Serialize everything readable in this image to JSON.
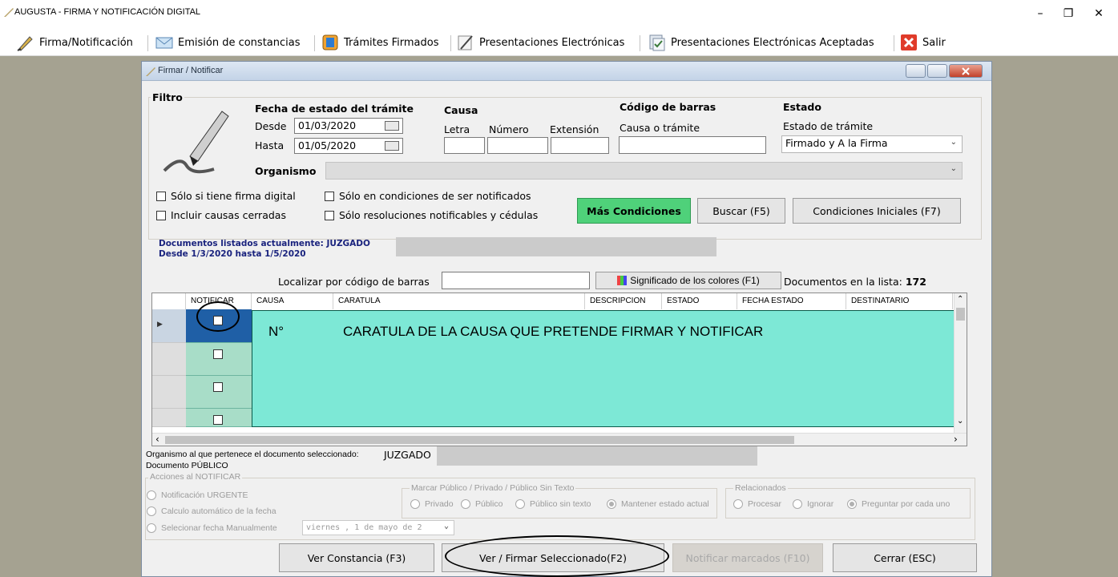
{
  "app": {
    "title": "AUGUSTA - FIRMA Y NOTIFICACIÓN DIGITAL",
    "controls": {
      "minimize": "–",
      "restore": "❐",
      "close": "✕"
    }
  },
  "toolbar": {
    "items": [
      {
        "label": "Firma/Notificación",
        "icon": "pen-icon"
      },
      {
        "label": "Emisión de constancias",
        "icon": "envelope-icon"
      },
      {
        "label": "Trámites Firmados",
        "icon": "signed-book-icon"
      },
      {
        "label": "Presentaciones Electrónicas",
        "icon": "pen-document-icon"
      },
      {
        "label": "Presentaciones Electrónicas Aceptadas",
        "icon": "accepted-documents-icon"
      },
      {
        "label": "Salir",
        "icon": "exit-icon"
      }
    ]
  },
  "dialog": {
    "title": "Firmar / Notificar",
    "filter": {
      "legend": "Filtro",
      "fecha_heading": "Fecha de estado del trámite",
      "desde_label": "Desde",
      "desde_value": "01/03/2020",
      "hasta_label": "Hasta",
      "hasta_value": "01/05/2020",
      "causa_heading": "Causa",
      "letra_label": "Letra",
      "numero_label": "Número",
      "extension_label": "Extensión",
      "codigo_heading": "Código de barras",
      "codigo_label": "Causa o trámite",
      "estado_heading": "Estado",
      "estado_label": "Estado de trámite",
      "estado_value": "Firmado y A la Firma",
      "organismo_label": "Organismo",
      "checks": [
        {
          "label": "Sólo si tiene firma digital",
          "checked": false
        },
        {
          "label": "Sólo en condiciones de ser notificados",
          "checked": false
        },
        {
          "label": "Incluir causas cerradas",
          "checked": false
        },
        {
          "label": "Sólo resoluciones notificables y cédulas",
          "checked": false
        }
      ],
      "mas_condiciones": "Más Condiciones",
      "buscar": "Buscar (F5)",
      "condiciones_iniciales": "Condiciones Iniciales (F7)"
    },
    "listing": {
      "line1": "Documentos listados actualmente: JUZGADO",
      "line2": "Desde 1/3/2020 hasta 1/5/2020"
    },
    "localizar_label": "Localizar por código de barras",
    "significado_button": "Significado de los colores (F1)",
    "doc_count_label": "Documentos en la lista:",
    "doc_count": "172",
    "grid": {
      "columns": [
        "NOTIFICAR",
        "CAUSA",
        "CARATULA",
        "DESCRIPCION",
        "ESTADO",
        "FECHA ESTADO",
        "DESTINATARIO"
      ],
      "overlay_n": "N°",
      "overlay_text": "CARATULA DE LA CAUSA QUE PRETENDE FIRMAR Y NOTIFICAR"
    },
    "organismo_line_label": "Organismo al que pertenece el documento seleccionado:",
    "organismo_line_value": "JUZGADO",
    "documento_line": "Documento PÚBLICO",
    "acciones": {
      "legend": "Acciones al NOTIFICAR",
      "urgente": "Notificación URGENTE",
      "calculo": "Calculo automático de la fecha",
      "seleccionar": "Selecionar fecha Manualmente",
      "fecha_value": "viernes ,  1 de   mayo   de 2"
    },
    "marcar": {
      "legend": "Marcar Público / Privado / Público Sin Texto",
      "options": [
        "Privado",
        "Público",
        "Público sin texto",
        "Mantener estado actual"
      ],
      "selected": 3
    },
    "relacionados": {
      "legend": "Relacionados",
      "options": [
        "Procesar",
        "Ignorar",
        "Preguntar por cada uno"
      ],
      "selected": 2
    },
    "buttons": {
      "ver_constancia": "Ver Constancia (F3)",
      "ver_firmar": "Ver / Firmar  Seleccionado(F2)",
      "notificar": "Notificar marcados (F10)",
      "cerrar": "Cerrar (ESC)"
    }
  },
  "colors": {
    "desktop": "#a5a291",
    "mas_condiciones_bg": "#4fd17a",
    "overlay_bg": "#7de8d6",
    "notificar_cell": "#a8ddc8"
  }
}
